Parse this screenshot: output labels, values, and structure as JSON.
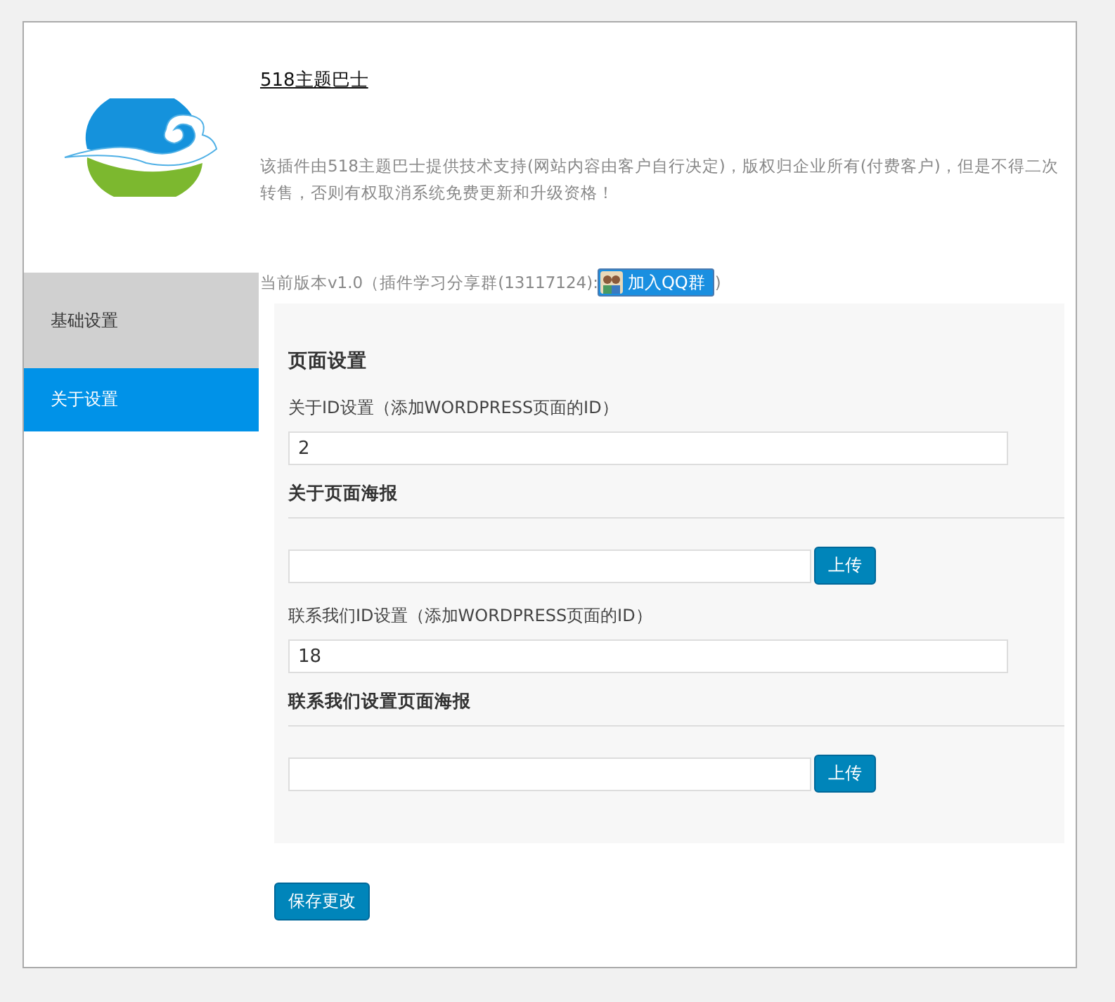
{
  "title_link": "518主题巴士",
  "description": "该插件由518主题巴士提供技术支持(网站内容由客户自行决定)，版权归企业所有(付费客户)，但是不得二次转售，否则有权取消系统免费更新和升级资格！",
  "version": {
    "text": "当前版本v1.0（插件学习分享群(13117124):",
    "qq_button": "加入QQ群",
    "closing": ")"
  },
  "sidebar": {
    "items": [
      {
        "label": "基础设置",
        "selected": false
      },
      {
        "label": "关于设置",
        "selected": true
      }
    ]
  },
  "section": {
    "title": "页面设置",
    "fields": [
      {
        "kind": "text",
        "label": "关于ID设置（添加WORDPRESS页面的ID）",
        "value": "2"
      },
      {
        "kind": "upload",
        "heading": "关于页面海报",
        "button": "上传"
      },
      {
        "kind": "text",
        "label": "联系我们ID设置（添加WORDPRESS页面的ID）",
        "value": "18"
      },
      {
        "kind": "upload",
        "heading": "联系我们设置页面海报",
        "button": "上传"
      }
    ]
  },
  "save_button": "保存更改"
}
